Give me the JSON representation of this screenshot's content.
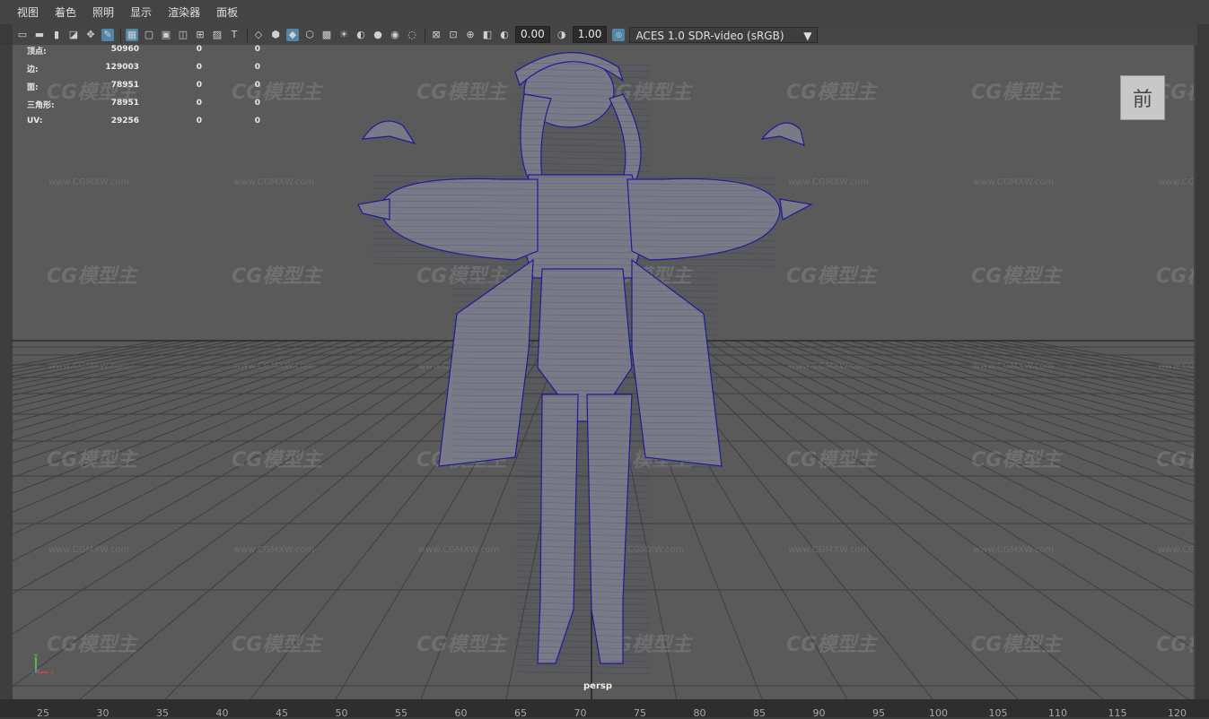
{
  "menu": [
    "视图",
    "着色",
    "照明",
    "显示",
    "渲染器",
    "面板"
  ],
  "toolbar": {
    "exposure_value": "0.00",
    "gamma_value": "1.00",
    "color_space": "ACES 1.0 SDR-video (sRGB)",
    "icons": [
      "camera-select-icon",
      "camera-attributes-icon",
      "bookmark-icon",
      "image-plane-icon",
      "2d-pan-zoom-icon",
      "grease-pencil-icon",
      "grid-icon",
      "film-gate-icon",
      "resolution-gate-icon",
      "gate-mask-icon",
      "field-chart-icon",
      "safe-action-icon",
      "safe-title-icon",
      "wireframe-icon",
      "smooth-shade-icon",
      "default-material-icon",
      "wireframe-on-shaded-icon",
      "xray-icon",
      "use-all-lights-icon",
      "shadows-icon",
      "ambient-occlusion-icon",
      "motion-blur-icon",
      "anti-aliasing-icon",
      "isolate-select-icon",
      "xray-active-icon",
      "xray-joints-icon",
      "backface-icon",
      "exposure-icon",
      "gamma-icon",
      "color-management-icon"
    ]
  },
  "hud": {
    "rows": [
      {
        "label": "顶点:",
        "v1": "50960",
        "v2": "0",
        "v3": "0"
      },
      {
        "label": "边:",
        "v1": "129003",
        "v2": "0",
        "v3": "0"
      },
      {
        "label": "面:",
        "v1": "78951",
        "v2": "0",
        "v3": "0"
      },
      {
        "label": "三角形:",
        "v1": "78951",
        "v2": "0",
        "v3": "0"
      },
      {
        "label": "UV:",
        "v1": "29256",
        "v2": "0",
        "v3": "0"
      }
    ]
  },
  "viewcube_label": "前",
  "camera_label": "persp",
  "axis": {
    "y": "y",
    "x": "x",
    "z": "z"
  },
  "ruler_ticks": [
    "25",
    "30",
    "35",
    "40",
    "45",
    "50",
    "55",
    "60",
    "65",
    "70",
    "75",
    "80",
    "85",
    "90",
    "95",
    "100",
    "105",
    "110",
    "115",
    "120"
  ],
  "watermark": {
    "brand": "CG模型主",
    "url": "www.CGMXW.com"
  },
  "colors": {
    "wireframe": "#1c1c9a",
    "viewport_bg": "#5a5a5a",
    "active_button": "#5285a6"
  }
}
